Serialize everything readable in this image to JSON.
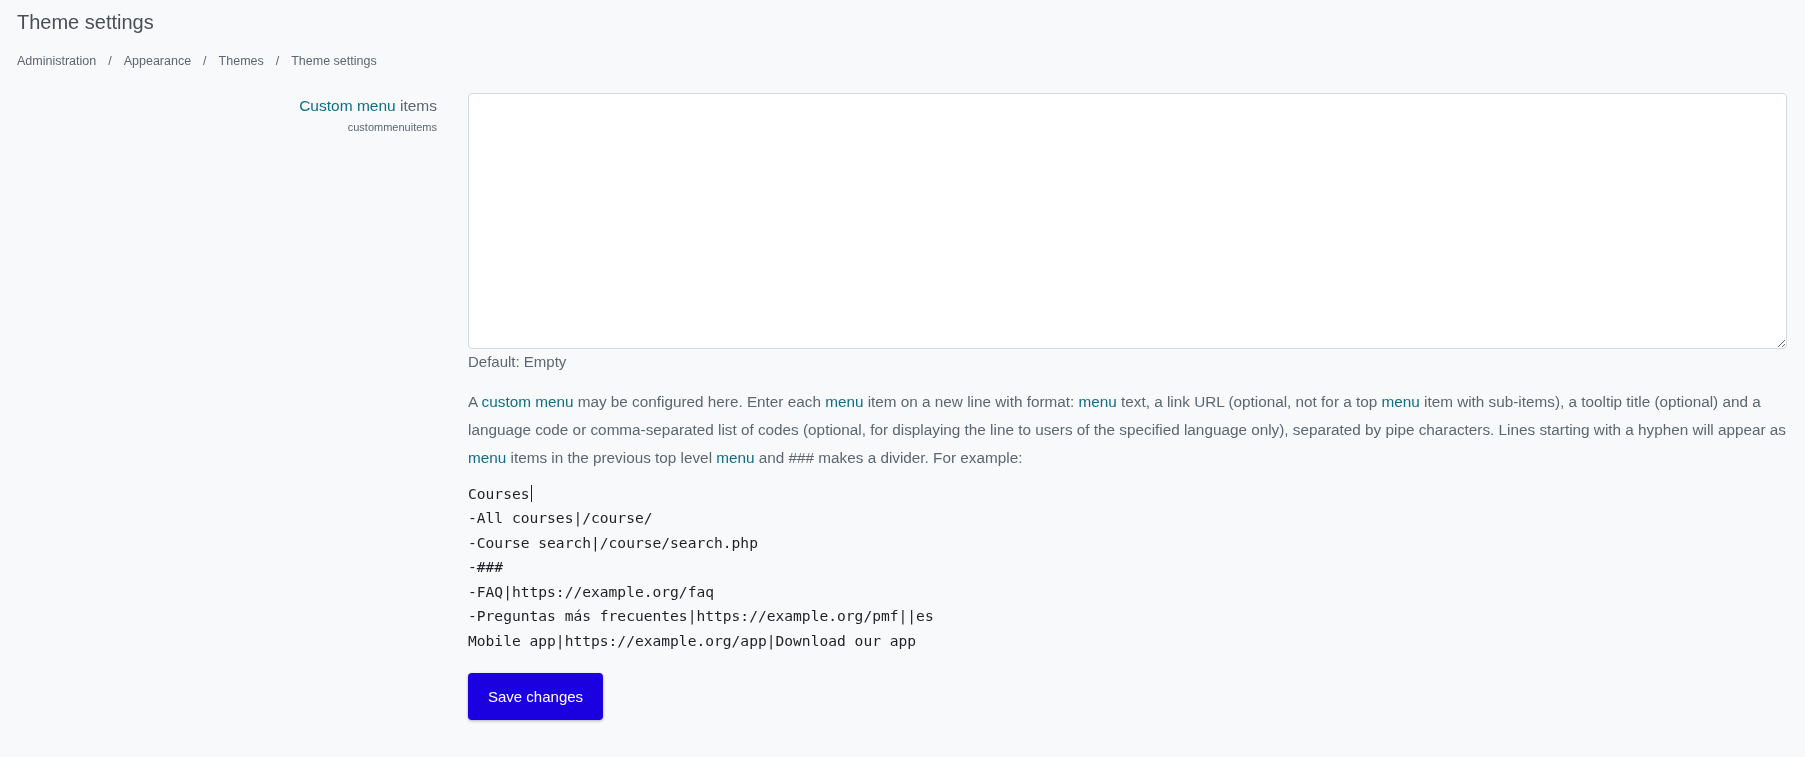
{
  "page_title": "Theme settings",
  "breadcrumb": [
    "Administration",
    "Appearance",
    "Themes",
    "Theme settings"
  ],
  "breadcrumb_separator": "/",
  "setting": {
    "label": [
      {
        "kind": "link",
        "text": "Custom menu"
      },
      {
        "kind": "text",
        "text": " items"
      }
    ],
    "name": "custommenuitems",
    "default": "Default: Empty",
    "description": [
      {
        "kind": "text",
        "text": "A "
      },
      {
        "kind": "link",
        "text": "custom menu"
      },
      {
        "kind": "text",
        "text": " may be configured here. Enter each "
      },
      {
        "kind": "link",
        "text": "menu"
      },
      {
        "kind": "text",
        "text": " item on a new line with format: "
      },
      {
        "kind": "link",
        "text": "menu"
      },
      {
        "kind": "text",
        "text": " text, a link URL (optional, not for a top "
      },
      {
        "kind": "link",
        "text": "menu"
      },
      {
        "kind": "text",
        "text": " item with sub-items), a tooltip title (optional) and a language code or comma-separated list of codes (optional, for displaying the line to users of the specified language only), separated by pipe characters. Lines starting with a hyphen will appear as "
      },
      {
        "kind": "link",
        "text": "menu"
      },
      {
        "kind": "text",
        "text": " items in the previous top level "
      },
      {
        "kind": "link",
        "text": "menu"
      },
      {
        "kind": "text",
        "text": " and ### makes a divider. For example:"
      }
    ],
    "example": [
      "Courses",
      "-All courses|/course/",
      "-Course search|/course/search.php",
      "-###",
      "-FAQ|https://example.org/faq",
      "-Preguntas más frecuentes|https://example.org/pmf||es",
      "Mobile app|https://example.org/app|Download our app"
    ]
  },
  "save_button": "Save changes"
}
